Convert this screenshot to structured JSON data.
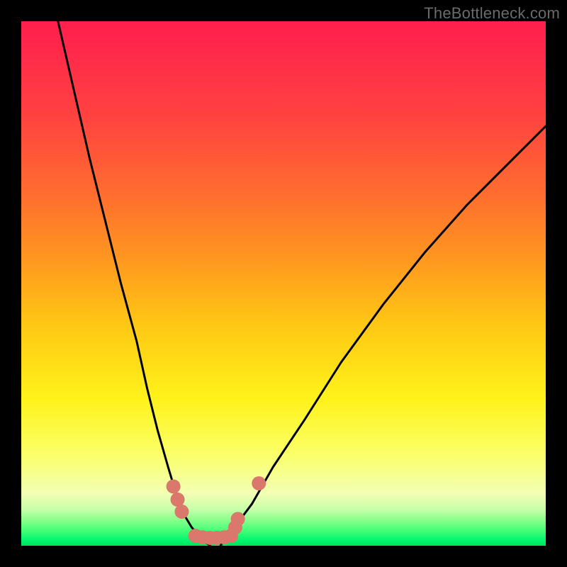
{
  "watermark": "TheBottleneck.com",
  "chart_data": {
    "type": "line",
    "title": "",
    "xlabel": "",
    "ylabel": "",
    "xlim": [
      0,
      100
    ],
    "ylim": [
      0,
      100
    ],
    "grid": false,
    "note": "No axes, ticks, or legend are visible. Values below are estimated from pixel positions: x is horizontal position (0 left → 100 right of plot area), y is vertical (0 bottom → 100 top).",
    "series": [
      {
        "name": "left-curve",
        "stroke": "#000000",
        "x": [
          7,
          10,
          13,
          16,
          19,
          22,
          24,
          26,
          28,
          29.5,
          31,
          32.5,
          34,
          35,
          36
        ],
        "y": [
          100,
          87,
          74,
          62,
          50,
          39,
          30,
          22,
          15,
          10,
          6,
          3.5,
          1.8,
          0.8,
          0
        ]
      },
      {
        "name": "right-curve",
        "stroke": "#000000",
        "x": [
          38,
          39,
          41,
          44,
          48,
          54,
          61,
          69,
          77,
          85,
          92,
          98,
          100
        ],
        "y": [
          0,
          1.5,
          4,
          8,
          15,
          24,
          35,
          46,
          56,
          65,
          72,
          78,
          80
        ]
      },
      {
        "name": "left-dots",
        "type": "scatter",
        "color": "#d9786b",
        "marker_size": 10,
        "x": [
          29.0,
          29.8,
          30.6
        ],
        "y": [
          11.3,
          8.8,
          6.5
        ]
      },
      {
        "name": "bottom-dots",
        "type": "scatter",
        "color": "#d9786b",
        "marker_size": 10,
        "x": [
          33.2,
          34.6,
          36.0,
          37.3,
          38.7,
          40.0
        ],
        "y": [
          1.9,
          1.6,
          1.5,
          1.5,
          1.6,
          1.9
        ]
      },
      {
        "name": "right-dots",
        "type": "scatter",
        "color": "#d9786b",
        "marker_size": 10,
        "x": [
          40.8,
          41.3,
          45.3
        ],
        "y": [
          3.5,
          5.1,
          11.9
        ]
      }
    ]
  }
}
